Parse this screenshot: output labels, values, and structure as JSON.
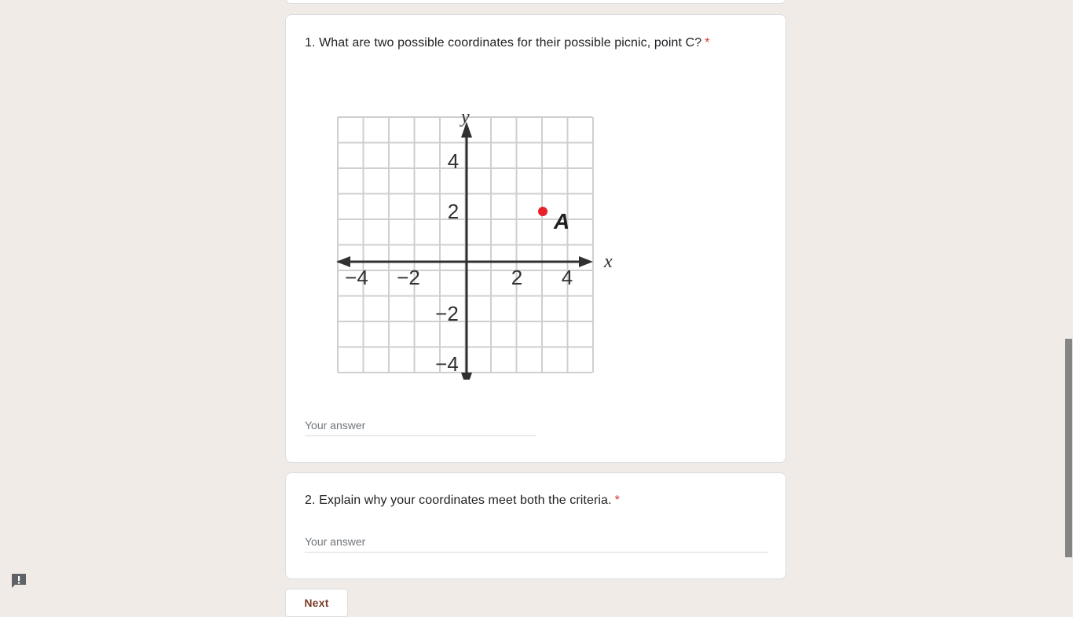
{
  "questions": [
    {
      "title": "1. What are two possible coordinates for their possible picnic, point C?",
      "required_marker": "*",
      "answer_placeholder": "Your answer",
      "figure": {
        "axis_x": "x",
        "axis_y": "y",
        "x_ticks": [
          "−4",
          "−2",
          "2",
          "4"
        ],
        "y_ticks": [
          "4",
          "2",
          "−2",
          "−4"
        ],
        "point_label": "A",
        "point_x": 3,
        "point_y": 2,
        "point_color": "#e8202a"
      }
    },
    {
      "title": "2. Explain why your coordinates meet both the criteria.",
      "required_marker": "*",
      "answer_placeholder": "Your answer"
    }
  ],
  "navigation": {
    "next_label": "Next"
  },
  "icons": {
    "feedback": "report-problem-icon"
  },
  "colors": {
    "background": "#f0ebe6",
    "required": "#d93025",
    "next_text": "#7a3e2a"
  }
}
